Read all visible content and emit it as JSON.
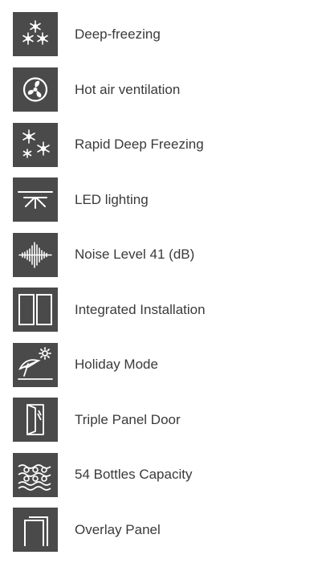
{
  "colors": {
    "icon_background": "#4a4a4a",
    "icon_foreground": "#ffffff",
    "label_text": "#3a3a3a"
  },
  "features": [
    {
      "label": "Deep-freezing",
      "icon": "snowflakes-triangle-icon"
    },
    {
      "label": "Hot air ventilation",
      "icon": "fan-icon"
    },
    {
      "label": "Rapid Deep Freezing",
      "icon": "snowflakes-cluster-icon"
    },
    {
      "label": "LED lighting",
      "icon": "led-light-icon"
    },
    {
      "label": "Noise Level 41 (dB)",
      "icon": "sound-wave-icon"
    },
    {
      "label": "Integrated Installation",
      "icon": "double-panel-icon"
    },
    {
      "label": "Holiday Mode",
      "icon": "beach-umbrella-sun-icon"
    },
    {
      "label": "Triple Panel Door",
      "icon": "glass-door-icon"
    },
    {
      "label": "54 Bottles Capacity",
      "icon": "bottles-rack-icon"
    },
    {
      "label": "Overlay Panel",
      "icon": "overlay-panel-icon"
    }
  ]
}
